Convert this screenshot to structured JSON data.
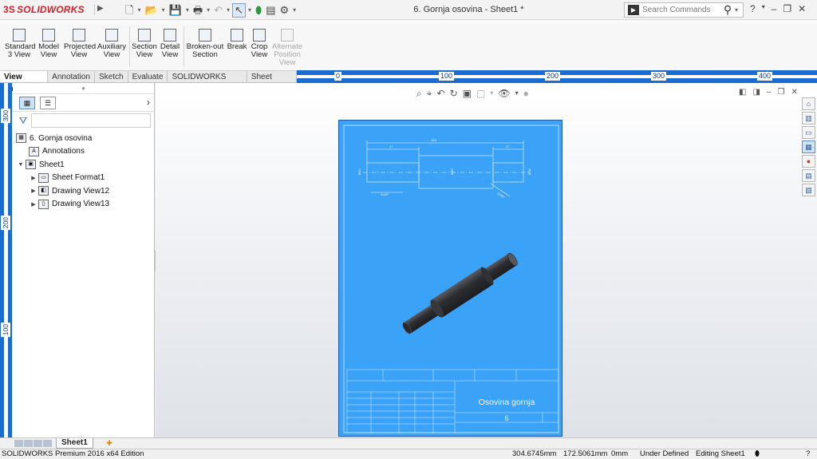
{
  "app": {
    "name": "SOLIDWORKS",
    "window_title": "6. Gornja osovina - Sheet1 *",
    "search_placeholder": "Search Commands",
    "help": "?"
  },
  "ribbon": {
    "buttons": [
      {
        "label1": "Standard",
        "label2": "3 View",
        "icon": "standard-3-view-icon"
      },
      {
        "label1": "Model",
        "label2": "View",
        "icon": "model-view-icon"
      },
      {
        "label1": "Projected",
        "label2": "View",
        "icon": "projected-view-icon"
      },
      {
        "label1": "Auxiliary",
        "label2": "View",
        "icon": "auxiliary-view-icon"
      },
      {
        "label1": "Section",
        "label2": "View",
        "icon": "section-view-icon"
      },
      {
        "label1": "Detail",
        "label2": "View",
        "icon": "detail-view-icon"
      },
      {
        "label1": "Broken-out",
        "label2": "Section",
        "icon": "broken-out-section-icon"
      },
      {
        "label1": "Break",
        "label2": "",
        "icon": "break-icon"
      },
      {
        "label1": "Crop",
        "label2": "View",
        "icon": "crop-view-icon"
      },
      {
        "label1": "Alternate",
        "label2": "Position",
        "label3": "View",
        "icon": "alternate-position-view-icon",
        "disabled": true
      }
    ]
  },
  "tabs": [
    "View Layout",
    "Annotation",
    "Sketch",
    "Evaluate",
    "SOLIDWORKS Add-Ins",
    "Sheet Format"
  ],
  "ruler": {
    "h_labels": [
      "0",
      "100",
      "200",
      "300",
      "400"
    ],
    "v_labels": [
      "300",
      "200",
      "100"
    ]
  },
  "tree": {
    "root": "6. Gornja osovina",
    "items": [
      {
        "label": "Annotations",
        "indent": 1,
        "arrow": ""
      },
      {
        "label": "Sheet1",
        "indent": 0,
        "arrow": "▼"
      },
      {
        "label": "Sheet Format1",
        "indent": 1,
        "arrow": "▶"
      },
      {
        "label": "Drawing View12",
        "indent": 1,
        "arrow": "▶"
      },
      {
        "label": "Drawing View13",
        "indent": 1,
        "arrow": "▶"
      }
    ]
  },
  "drawing": {
    "dims": {
      "overall": "163",
      "left": "47",
      "right": "37",
      "d1": "Ø30",
      "d2": "Ø40",
      "d3": "Ø28",
      "chamfer_left": "2x45°",
      "chamfer_right": "2x45°"
    },
    "title_block": {
      "title": "Osovina gornja",
      "number": "6"
    }
  },
  "sheet_tab": "Sheet1",
  "status": {
    "edition": "SOLIDWORKS Premium 2016 x64 Edition",
    "x": "304.6745mm",
    "y": "172.5061mm",
    "z": "0mm",
    "state": "Under Defined",
    "editing": "Editing Sheet1"
  }
}
